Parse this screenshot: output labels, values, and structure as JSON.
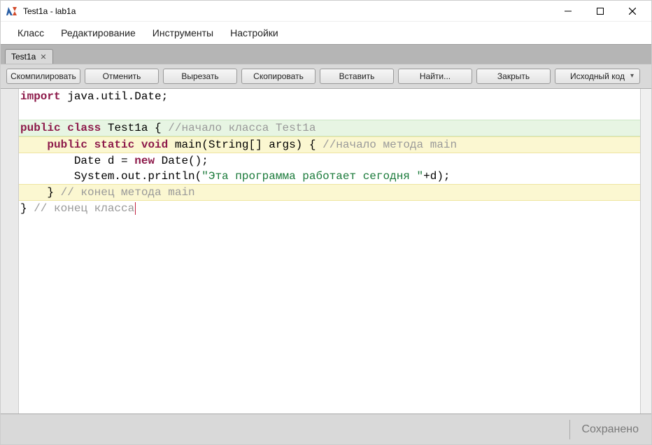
{
  "window": {
    "title": "Test1a - lab1a"
  },
  "menu": {
    "class": "Класс",
    "edit": "Редактирование",
    "tools": "Инструменты",
    "settings": "Настройки"
  },
  "tabs": [
    {
      "label": "Test1a"
    }
  ],
  "toolbar": {
    "compile": "Скомпилировать",
    "undo": "Отменить",
    "cut": "Вырезать",
    "copy": "Скопировать",
    "paste": "Вставить",
    "find": "Найти...",
    "close": "Закрыть",
    "source": "Исходный код"
  },
  "code": {
    "l1_kw": "import",
    "l1_rest": " java.util.Date;",
    "l3_kw1": "public",
    "l3_kw2": "class",
    "l3_cls": "Test1a",
    "l3_brace": " { ",
    "l3_cmt": "//начало класса Test1a",
    "l4_indent": "    ",
    "l4_kw1": "public",
    "l4_kw2": "static",
    "l4_kw3": "void",
    "l4_sig": " main(String[] args) { ",
    "l4_cmt": "//начало метода main",
    "l5_indent": "        ",
    "l5_a": "Date d = ",
    "l5_kw": "new",
    "l5_b": " Date();",
    "l6_indent": "        ",
    "l6_a": "System.out.println(",
    "l6_str": "\"Эта программа работает сегодня \"",
    "l6_b": "+d);",
    "l7_indent": "    ",
    "l7_brace": "} ",
    "l7_cmt": "// конец метода main",
    "l8_brace": "} ",
    "l8_cmt": "// конец класса"
  },
  "status": {
    "saved": "Сохранено"
  }
}
